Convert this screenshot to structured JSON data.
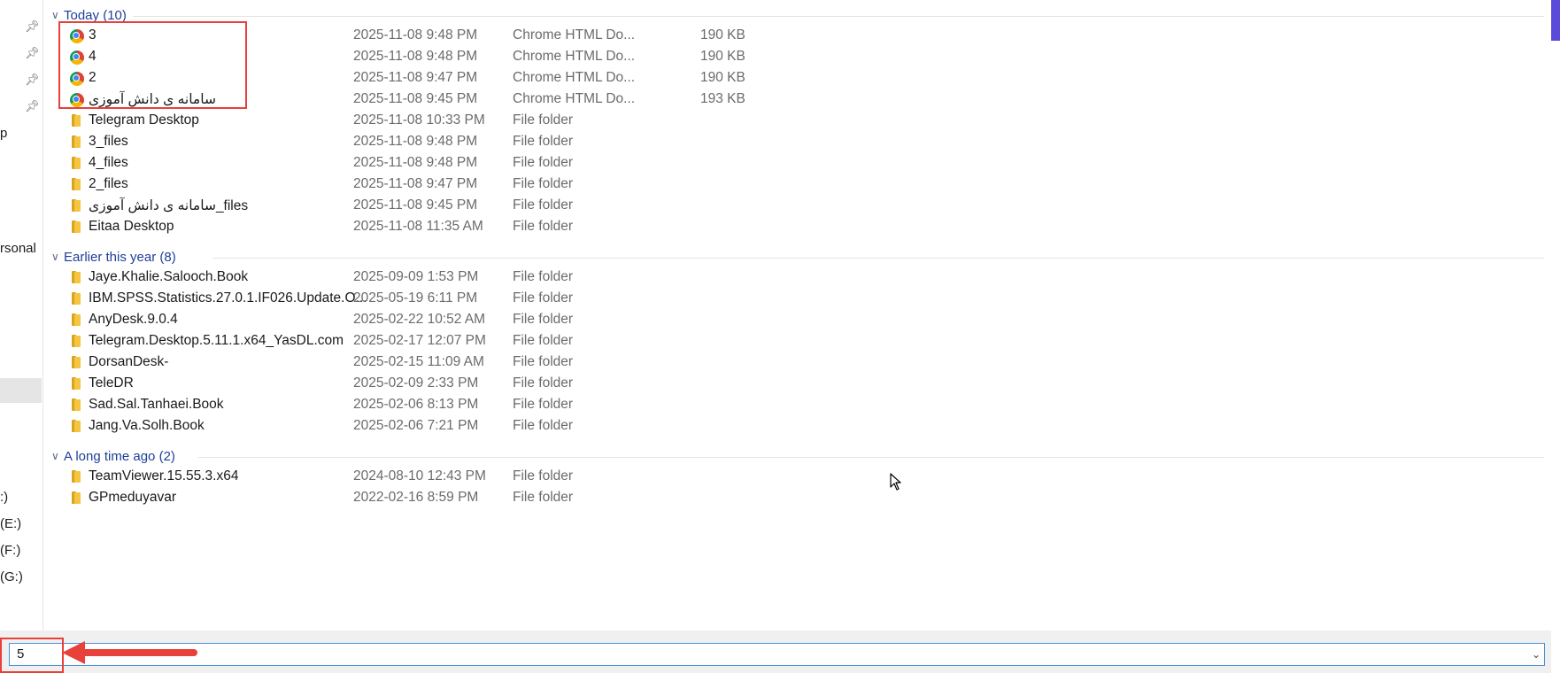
{
  "nav": {
    "text_p": "p",
    "text_personal": "rsonal",
    "drives": [
      ":)",
      "(E:)",
      "(F:)",
      "(G:)"
    ]
  },
  "groups": [
    {
      "label": "Today (10)",
      "rows": [
        {
          "name": "3",
          "date": "2025-11-08 9:48 PM",
          "type": "Chrome HTML Do...",
          "size": "190 KB",
          "icon": "chrome-icon"
        },
        {
          "name": "4",
          "date": "2025-11-08 9:48 PM",
          "type": "Chrome HTML Do...",
          "size": "190 KB",
          "icon": "chrome-icon"
        },
        {
          "name": "2",
          "date": "2025-11-08 9:47 PM",
          "type": "Chrome HTML Do...",
          "size": "190 KB",
          "icon": "chrome-icon"
        },
        {
          "name": "سامانه ی دانش آموزی",
          "date": "2025-11-08 9:45 PM",
          "type": "Chrome HTML Do...",
          "size": "193 KB",
          "icon": "chrome-icon"
        },
        {
          "name": "Telegram Desktop",
          "date": "2025-11-08 10:33 PM",
          "type": "File folder",
          "size": "",
          "icon": "folder-icon"
        },
        {
          "name": "3_files",
          "date": "2025-11-08 9:48 PM",
          "type": "File folder",
          "size": "",
          "icon": "folder-icon"
        },
        {
          "name": "4_files",
          "date": "2025-11-08 9:48 PM",
          "type": "File folder",
          "size": "",
          "icon": "folder-icon"
        },
        {
          "name": "2_files",
          "date": "2025-11-08 9:47 PM",
          "type": "File folder",
          "size": "",
          "icon": "folder-icon"
        },
        {
          "name": "سامانه ی دانش آموزی_files",
          "date": "2025-11-08 9:45 PM",
          "type": "File folder",
          "size": "",
          "icon": "folder-icon"
        },
        {
          "name": "Eitaa Desktop",
          "date": "2025-11-08 11:35 AM",
          "type": "File folder",
          "size": "",
          "icon": "folder-icon"
        }
      ]
    },
    {
      "label": "Earlier this year (8)",
      "rows": [
        {
          "name": "Jaye.Khalie.Salooch.Book",
          "date": "2025-09-09 1:53 PM",
          "type": "File folder",
          "size": "",
          "icon": "folder-icon"
        },
        {
          "name": "IBM.SPSS.Statistics.27.0.1.IF026.Update.O...",
          "date": "2025-05-19 6:11 PM",
          "type": "File folder",
          "size": "",
          "icon": "folder-icon"
        },
        {
          "name": "AnyDesk.9.0.4",
          "date": "2025-02-22 10:52 AM",
          "type": "File folder",
          "size": "",
          "icon": "folder-icon"
        },
        {
          "name": "Telegram.Desktop.5.11.1.x64_YasDL.com",
          "date": "2025-02-17 12:07 PM",
          "type": "File folder",
          "size": "",
          "icon": "folder-icon"
        },
        {
          "name": "DorsanDesk-",
          "date": "2025-02-15 11:09 AM",
          "type": "File folder",
          "size": "",
          "icon": "folder-icon"
        },
        {
          "name": "TeleDR",
          "date": "2025-02-09 2:33 PM",
          "type": "File folder",
          "size": "",
          "icon": "folder-icon"
        },
        {
          "name": "Sad.Sal.Tanhaei.Book",
          "date": "2025-02-06 8:13 PM",
          "type": "File folder",
          "size": "",
          "icon": "folder-icon"
        },
        {
          "name": "Jang.Va.Solh.Book",
          "date": "2025-02-06 7:21 PM",
          "type": "File folder",
          "size": "",
          "icon": "folder-icon"
        }
      ]
    },
    {
      "label": "A long time ago (2)",
      "rows": [
        {
          "name": "TeamViewer.15.55.3.x64",
          "date": "2024-08-10 12:43 PM",
          "type": "File folder",
          "size": "",
          "icon": "folder-icon"
        },
        {
          "name": "GPmeduyavar",
          "date": "2022-02-16 8:59 PM",
          "type": "File folder",
          "size": "",
          "icon": "folder-icon"
        }
      ]
    }
  ],
  "filename": {
    "value": "5"
  },
  "colors": {
    "highlight": "#e8403a",
    "group_header": "#1e3f99",
    "accent": "#5b4bdb"
  }
}
